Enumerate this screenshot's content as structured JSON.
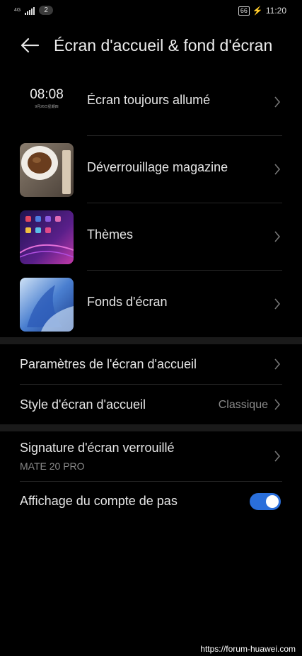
{
  "status_bar": {
    "network_label": "4G",
    "notification_count": "2",
    "battery_level": "66",
    "time": "11:20"
  },
  "header": {
    "title": "Écran d'accueil & fond d'écran",
    "back_icon": "back-arrow-icon"
  },
  "items": [
    {
      "label": "Écran toujours allumé",
      "thumb_time": "08:08",
      "thumb_date": "9月26日星期四"
    },
    {
      "label": "Déverrouillage magazine"
    },
    {
      "label": "Thèmes"
    },
    {
      "label": "Fonds d'écran"
    }
  ],
  "settings": {
    "home_params_label": "Paramètres de l'écran d'accueil",
    "home_style_label": "Style d'écran d'accueil",
    "home_style_value": "Classique",
    "lock_signature_label": "Signature d'écran verrouillé",
    "lock_signature_value": "MATE 20 PRO",
    "step_count_label": "Affichage du compte de pas",
    "step_count_enabled": true
  },
  "colors": {
    "background": "#000000",
    "accent": "#2a6fdb"
  },
  "watermark": "https://forum-huawei.com"
}
